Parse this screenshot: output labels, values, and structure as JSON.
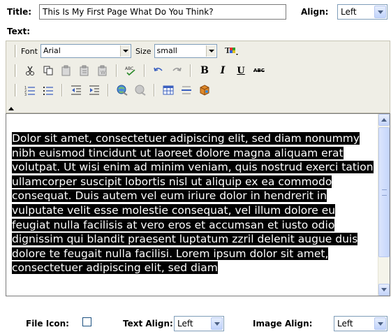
{
  "form": {
    "title_label": "Title:",
    "title_value": "This Is My First Page What Do You Think?",
    "align_label": "Align:",
    "align_value": "Left",
    "text_label": "Text:"
  },
  "toolbar": {
    "font_label": "Font",
    "font_value": "Arial",
    "size_label": "Size",
    "size_value": "small",
    "buttons_row2": [
      "scissors-icon",
      "copy-icon",
      "paste-icon",
      "paste-text-icon",
      "paste-word-icon",
      "spellcheck-icon",
      "undo-icon",
      "redo-icon",
      "bold-button",
      "italic-button",
      "underline-button",
      "strikethrough-button"
    ],
    "bold_glyph": "B",
    "italic_glyph": "I",
    "underline_glyph": "U",
    "strike_glyph": "ABC"
  },
  "content": {
    "text": "Dolor sit amet, consectetuer adipiscing elit, sed diam nonummy nibh euismod tincidunt ut laoreet dolore magna aliquam erat volutpat. Ut wisi enim ad minim veniam, quis nostrud exerci tation ullamcorper suscipit lobortis nisl ut aliquip ex ea commodo consequat. Duis autem vel eum iriure dolor in hendrerit in vulputate velit esse molestie consequat, vel illum dolore eu feugiat nulla facilisis at vero eros et accumsan et iusto odio dignissim qui blandit praesent luptatum zzril delenit augue duis dolore te feugait nulla facilisi. Lorem ipsum dolor sit amet, consectetuer adipiscing elit, sed diam"
  },
  "bottom": {
    "file_icon_label": "File Icon:",
    "file_icon_checked": false,
    "text_align_label": "Text Align:",
    "text_align_value": "Left",
    "image_align_label": "Image Align:",
    "image_align_value": "Left"
  }
}
